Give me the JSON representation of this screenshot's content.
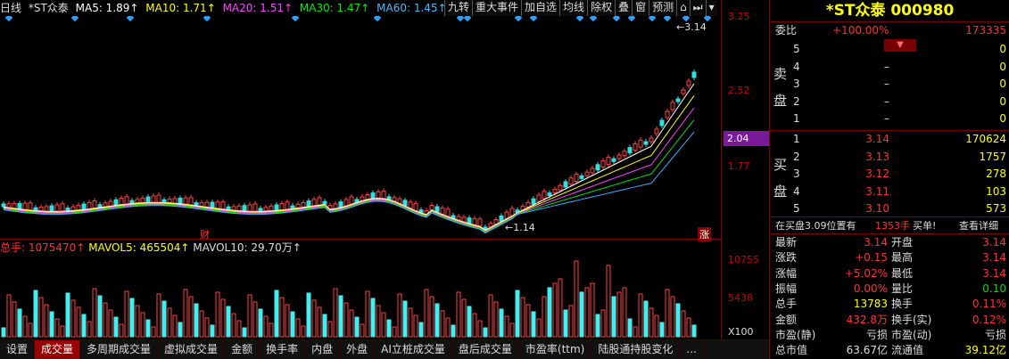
{
  "header": {
    "period": "日线",
    "name": "*ST众泰",
    "ma5": "MA5: 1.89↑",
    "ma10": "MA10: 1.71↑",
    "ma20": "MA20: 1.51↑",
    "ma30": "MA30: 1.47↑",
    "ma60": "MA60: 1.45↑",
    "colors": {
      "ma5": "#ffffff",
      "ma10": "#ffff00",
      "ma20": "#ff40ff",
      "ma30": "#00e000",
      "ma60": "#40b0ff"
    }
  },
  "toolbar": [
    "九转",
    "重大事件",
    "加自选",
    "均线",
    "除权",
    "叠",
    "窗",
    "预测"
  ],
  "price_axis": {
    "p325": "3.25",
    "p252": "2.52",
    "p204": "2.04",
    "p177": "1.77"
  },
  "annotations": {
    "high": "3.14",
    "low": "1.14",
    "cai": "财",
    "zhang": "涨"
  },
  "volume_header": {
    "total": "总手: 1075470↑",
    "mavol5": "MAVOL5: 465504↑",
    "mavol10": "MAVOL10: 29.70万↑"
  },
  "volume_axis": {
    "v1": "10755",
    "v2": "5438",
    "unit": "X100"
  },
  "tabs": [
    "设置",
    "成交量",
    "多周期成交量",
    "虚拟成交量",
    "金额",
    "换手率",
    "内盘",
    "外盘",
    "AI立桩成交量",
    "盘后成交量",
    "市盈率(ttm)",
    "陆股通持股变化",
    "..."
  ],
  "active_tab": 1,
  "stock": {
    "title": "*ST众泰 000980"
  },
  "order": {
    "weibi_label": "委比",
    "weibi_value": "+100.00%",
    "weicha_value": "173335"
  },
  "sell": [
    {
      "lvl": "5",
      "price": "",
      "vol": "0"
    },
    {
      "lvl": "4",
      "price": "–",
      "vol": "0"
    },
    {
      "lvl": "3",
      "price": "–",
      "vol": "0"
    },
    {
      "lvl": "2",
      "price": "–",
      "vol": "0"
    },
    {
      "lvl": "1",
      "price": "–",
      "vol": "0"
    }
  ],
  "sell_label": [
    "卖",
    "盘"
  ],
  "buy": [
    {
      "lvl": "1",
      "price": "3.14",
      "vol": "170624"
    },
    {
      "lvl": "2",
      "price": "3.13",
      "vol": "1757"
    },
    {
      "lvl": "3",
      "price": "3.12",
      "vol": "278"
    },
    {
      "lvl": "4",
      "price": "3.11",
      "vol": "103"
    },
    {
      "lvl": "5",
      "price": "3.10",
      "vol": "573"
    }
  ],
  "buy_label": [
    "买",
    "盘"
  ],
  "notice": {
    "text": "在买盘3.09位置有",
    "vol": "1353手",
    "action": "买单!",
    "link": "查看详细"
  },
  "quote": [
    {
      "l1": "最新",
      "v1": "3.14",
      "l2": "开盘",
      "v2": "3.14"
    },
    {
      "l1": "涨跌",
      "v1": "+0.15",
      "l2": "最高",
      "v2": "3.14"
    },
    {
      "l1": "涨幅",
      "v1": "+5.02%",
      "l2": "最低",
      "v2": "3.14"
    },
    {
      "l1": "振幅",
      "v1": "0.00%",
      "l2": "量比",
      "v2": "0.10"
    },
    {
      "l1": "总手",
      "v1": "13783",
      "l2": "换手",
      "v2": "0.11%"
    },
    {
      "l1": "金额",
      "v1": "432.8万",
      "l2": "换手(实)",
      "v2": "0.12%"
    },
    {
      "l1": "市盈(静)",
      "v1": "亏损",
      "l2": "市盈(动)",
      "v2": "亏损"
    },
    {
      "l1": "总市值",
      "v1": "63.67亿",
      "l2": "流通值",
      "v2": "39.12亿"
    }
  ]
}
